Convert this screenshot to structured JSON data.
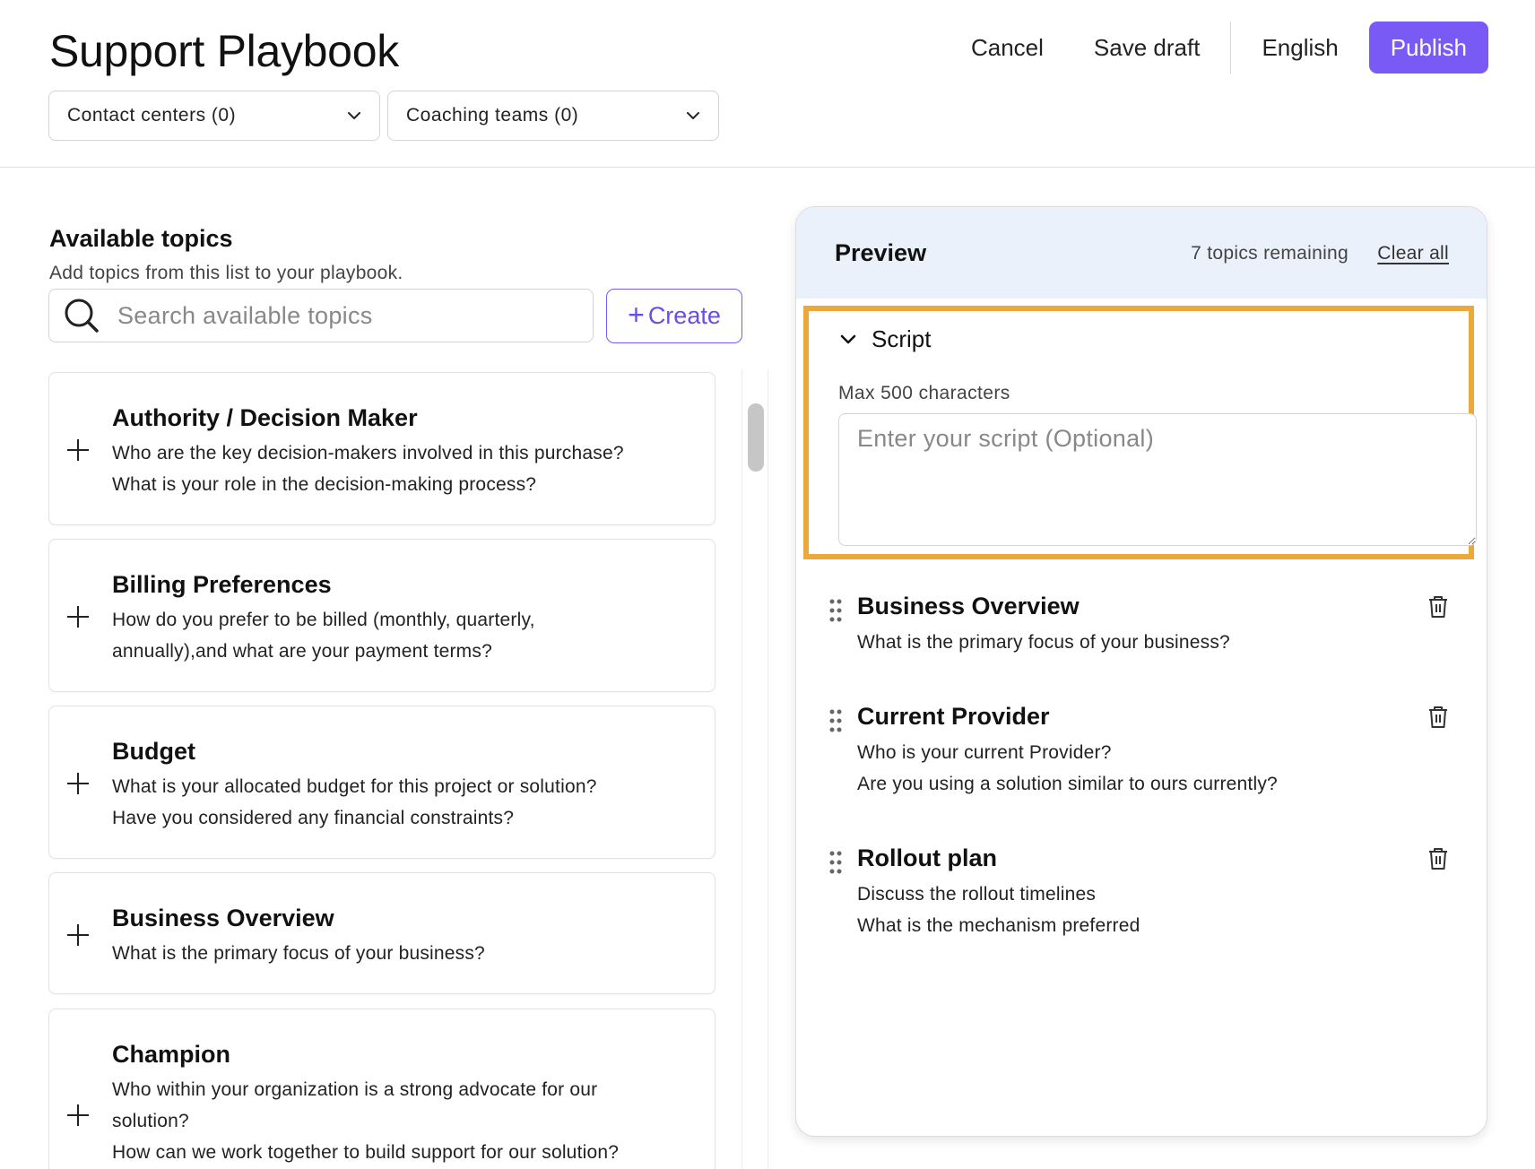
{
  "header": {
    "title": "Support Playbook",
    "cancel_label": "Cancel",
    "save_draft_label": "Save draft",
    "language_label": "English",
    "publish_label": "Publish",
    "colors": {
      "accent": "#7a5af5",
      "highlight": "#eaa93a"
    }
  },
  "filters": {
    "contact_centers": "Contact centers (0)",
    "coaching_teams": "Coaching teams (0)"
  },
  "available": {
    "title": "Available topics",
    "subtitle": "Add topics from this list to your playbook.",
    "search_placeholder": "Search available topics",
    "create_label": "Create",
    "topics": [
      {
        "title": "Authority / Decision Maker",
        "desc": [
          "Who are the key decision-makers involved in this purchase?",
          "What is your role in the decision-making process?"
        ]
      },
      {
        "title": "Billing Preferences",
        "desc": [
          "How do you prefer to be billed (monthly, quarterly,",
          "annually),and what are your payment terms?"
        ]
      },
      {
        "title": "Budget",
        "desc": [
          "What is your allocated budget for this project or solution?",
          "Have you considered any financial constraints?"
        ]
      },
      {
        "title": "Business Overview",
        "desc": [
          "What is the primary focus of your business?"
        ]
      },
      {
        "title": "Champion",
        "desc": [
          "Who within your organization is a strong advocate for our",
          "solution?",
          "How can we work together to build support for our solution?"
        ]
      }
    ]
  },
  "preview": {
    "title": "Preview",
    "remaining": "7 topics remaining",
    "clear_all": "Clear all",
    "script": {
      "label": "Script",
      "max_chars": "Max 500 characters",
      "placeholder": "Enter your script (Optional)"
    },
    "topics": [
      {
        "title": "Business Overview",
        "desc": [
          "What is the primary focus of your business?"
        ]
      },
      {
        "title": "Current Provider",
        "desc": [
          "Who is your current Provider?",
          "Are you using a solution similar to ours currently?"
        ]
      },
      {
        "title": "Rollout plan",
        "desc": [
          "Discuss the rollout timelines",
          "What is the mechanism preferred"
        ]
      }
    ]
  }
}
